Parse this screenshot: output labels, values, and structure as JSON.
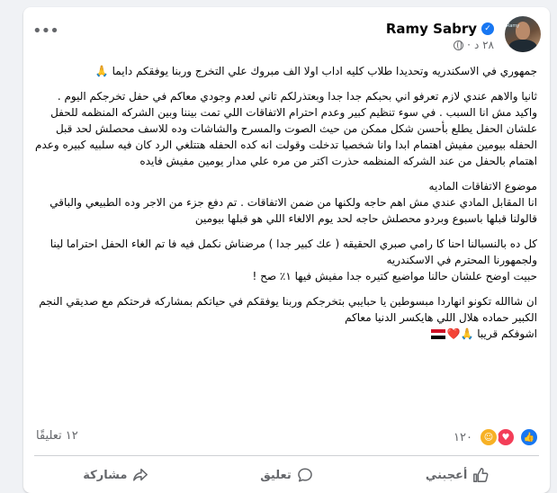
{
  "post": {
    "author": "Ramy Sabry",
    "timestamp": "٢٨ د",
    "avatar_brand": "Ramy",
    "body": [
      "جمهوري في الاسكندريه وتحديدا طلاب كليه اداب اولا الف مبروك علي التخرج وربنا يوفقكم دايما 🙏",
      "ثانيا والاهم عندي لازم تعرفو اني بحبكم جدا جدا وبعتذرلكم تاني لعدم وجودي معاكم في حفل تخرجكم اليوم . واكيد مش انا السبب . في سوء تنظيم كبير وعدم احترام الاتفاقات اللي تمت بيننا وبين الشركه المنظمه للحفل  علشان الحفل يطلع بأحسن شكل ممكن من حيث الصوت والمسرح والشاشات وده للاسف محصلش لحد قبل الحفله بيومين مفيش اهتمام ابدا وانا شخصيا تدخلت وقولت انه كده الحفله هتتلغي الرد كان فيه سلبيه كبيره وعدم اهتمام بالحفل من عند الشركه المنظمه حذرت اكتر من مره علي مدار يومين مفيش فايده",
      "موضوع الاتفاقات الماديه\nانا المقابل المادي عندي مش اهم حاجه ولكنها من ضمن الاتفاقات . تم دفع جزء من الاجر وده الطبيعي والباقي قالولنا قبلها باسبوع وبردو محصلش حاجه لحد يوم الالغاء اللي هو قبلها بيومين",
      "كل ده بالنسبالنا احنا كا رامي صبري الحقيقه ( عك كبير جدا ) مرضناش نكمل فيه فا تم الغاء الحفل احتراما لينا ولجمهورنا المحترم في الاسكندريه\nحبيت اوضح علشان حالنا مواضيع كتيره جدا  مفيش فيها  ١٪ صح !",
      "ان شاالله تكونو انهاردا مبسوطين يا حبايبي بتخرجكم وربنا يوفقكم في حياتكم بمشاركه فرحتكم مع صديقي النجم الكبير  حماده هلال اللي هايكسر الدنيا معاكم\nاشوفكم قريبا 🙏❤️"
    ]
  },
  "stats": {
    "reactions_count": "١٢٠",
    "comments_count": "١٢ تعليقًا"
  },
  "actions": {
    "like": "أعجبني",
    "comment": "تعليق",
    "share": "مشاركة"
  },
  "colors": {
    "like_blue": "#1877f2",
    "love_red": "#f33e58",
    "care_yellow": "#f7b125",
    "secondary_text": "#65676b"
  },
  "icons": [
    "verified-badge-icon",
    "globe-icon",
    "more-options-icon",
    "like-reaction-icon",
    "love-reaction-icon",
    "care-reaction-icon",
    "egypt-flag-icon",
    "like-icon",
    "comment-icon",
    "share-icon"
  ]
}
